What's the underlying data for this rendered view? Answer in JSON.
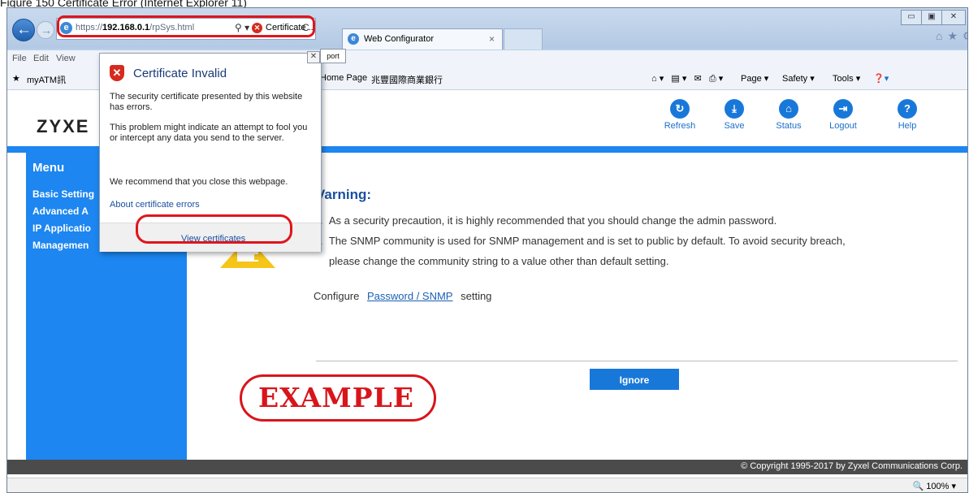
{
  "figure_caption": "Figure 150   Certificate Error (Internet Explorer 11)",
  "browser": {
    "url_prefix": "https://",
    "url_host": "192.168.0.1",
    "url_path": "/rpSys.html",
    "search_glyph": "⚲ ▾",
    "cert_error_label": "Certificate ...",
    "refresh_glyph": "C",
    "tab_title": "Web Configurator",
    "tab_close": "×",
    "window_buttons": [
      "▭",
      "▣",
      "✕"
    ],
    "toolbar_icons": "⌂★⚙",
    "menu": [
      "File",
      "Edit",
      "View"
    ],
    "favorites": [
      "myATM訊",
      "Home Page",
      "兆豐國際商業銀行"
    ],
    "commands": [
      "Page ▾",
      "Safety ▾",
      "Tools ▾"
    ],
    "zoom": "100%"
  },
  "popup": {
    "title": "Certificate Invalid",
    "tab_label": "port",
    "p1": "The security certificate presented by this website has errors.",
    "p2": "This problem might indicate an attempt to fool you or intercept any data you send to the server.",
    "p3": "We recommend that you close this webpage.",
    "link": "About certificate errors",
    "button": "View certificates"
  },
  "page": {
    "logo": "ZYXE",
    "toolbar": [
      {
        "label": "Refresh",
        "icon": "refresh-icon"
      },
      {
        "label": "Save",
        "icon": "save-icon"
      },
      {
        "label": "Status",
        "icon": "status-icon"
      },
      {
        "label": "Logout",
        "icon": "logout-icon"
      },
      {
        "label": "Help",
        "icon": "help-icon"
      }
    ],
    "menu_title": "Menu",
    "menu_items": [
      "Basic Setting",
      "Advanced A",
      "IP Applicatio",
      "Managemen"
    ],
    "warning_title": "Varning:",
    "warning_lines": [
      "As a security precaution, it is highly recommended that you should change the admin password.",
      "The SNMP community is used for SNMP management and is set to public by default. To avoid security breach,",
      "please change the community string to a value other than default setting."
    ],
    "configure_prefix": "Configure",
    "configure_link": "Password / SNMP",
    "configure_suffix": "setting",
    "ignore_button": "Ignore",
    "example_stamp": "EXAMPLE",
    "footer": "© Copyright 1995-2017 by Zyxel Communications Corp."
  }
}
